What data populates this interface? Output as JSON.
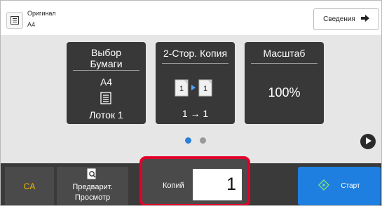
{
  "header": {
    "original_label": "Оригинал",
    "original_size": "A4",
    "original_icon": "document-list-icon",
    "details_button": "Сведения",
    "details_icon": "arrow-right-icon"
  },
  "tiles": {
    "paper": {
      "title_line1": "Выбор",
      "title_line2": "Бумаги",
      "size": "A4",
      "icon": "paper-tray-icon",
      "tray": "Лоток 1"
    },
    "duplex": {
      "title": "2-Стор. Копия",
      "icon": "one-sided-to-one-sided-icon",
      "icon_page_label": "1",
      "mode": "1 → 1"
    },
    "scale": {
      "title": "Масштаб",
      "value": "100%"
    }
  },
  "pager": {
    "page_count": 2,
    "active_page": 1
  },
  "bottom": {
    "ca_label": "CA",
    "preview_line1": "Предварит.",
    "preview_line2": "Просмотр",
    "preview_icon": "magnifier-document-icon",
    "copies_label": "Копий",
    "copies_value": "1",
    "start_label": "Старт",
    "start_icon": "start-diamond-icon"
  },
  "colors": {
    "tile_background": "#383838",
    "start_button": "#1f7fe0",
    "highlight_border": "#e0002a",
    "ca_text": "#f5b800",
    "active_dot": "#2a7fd8"
  }
}
